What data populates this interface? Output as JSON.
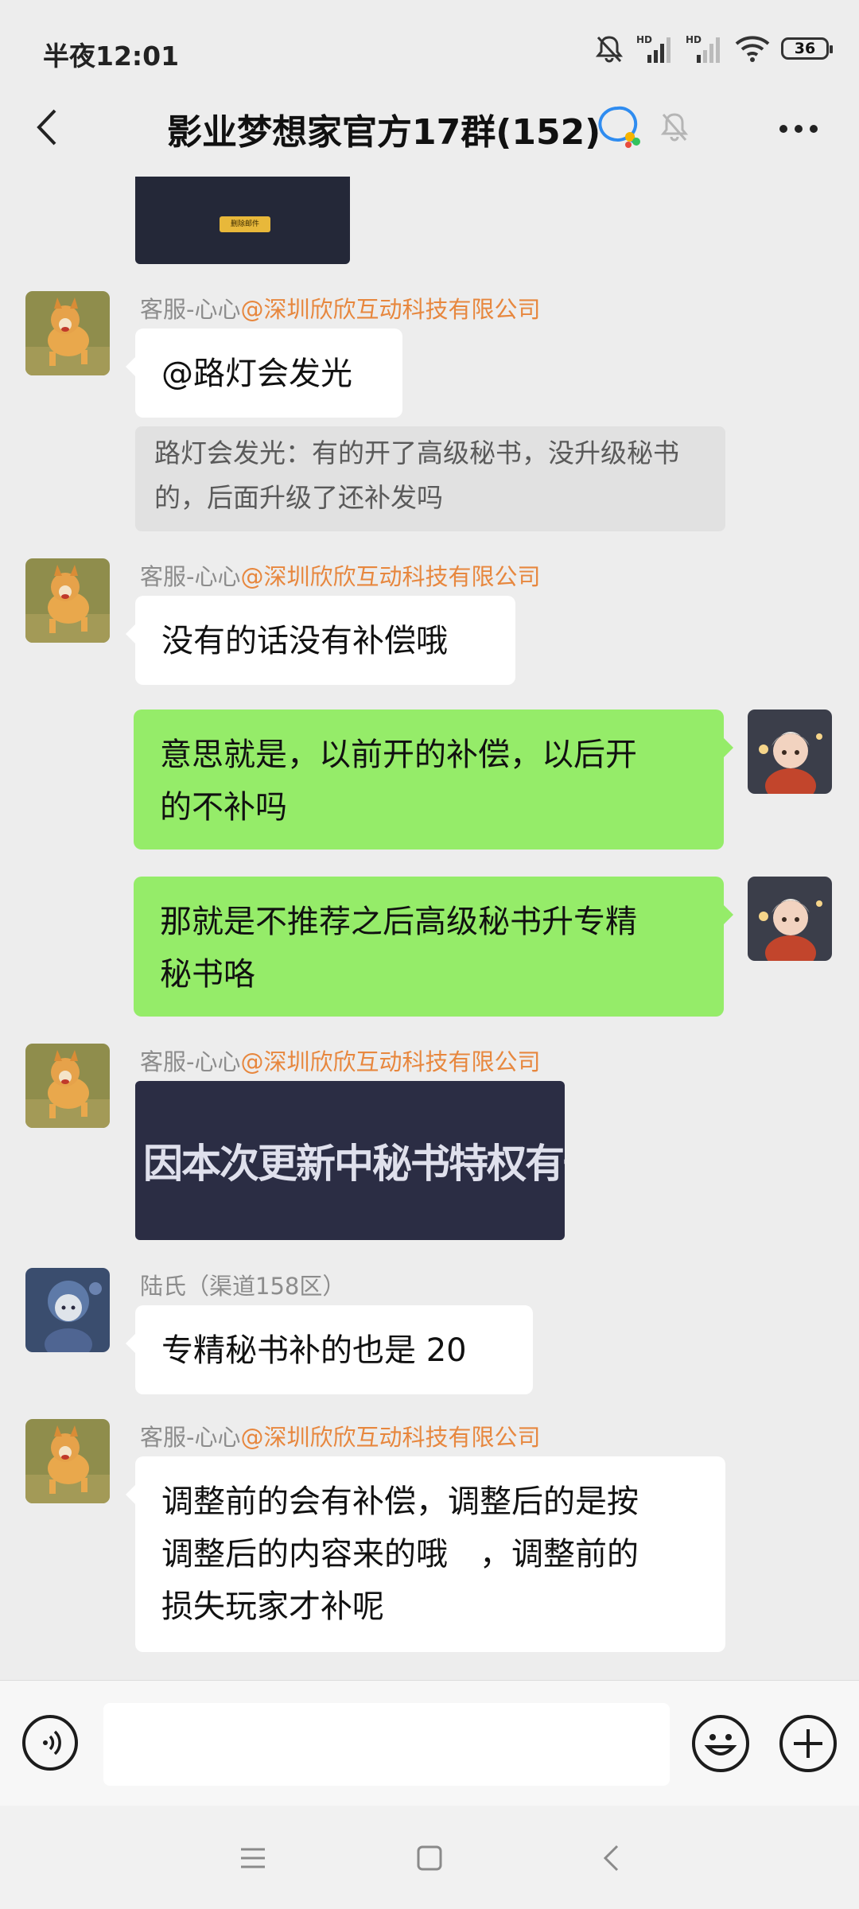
{
  "status_bar": {
    "time": "半夜12:01",
    "signal_1_label": "HD",
    "signal_2_label": "HD",
    "battery": "36",
    "icons": [
      "mute-notification-icon",
      "signal-icon",
      "signal-icon",
      "wifi-icon",
      "battery-icon"
    ]
  },
  "header": {
    "title": "影业梦想家官方17群(152)",
    "icons": [
      "back-icon",
      "group-chat-icon",
      "bell-muted-icon",
      "more-icon"
    ]
  },
  "messages": [
    {
      "type": "image",
      "side": "left",
      "partial": true,
      "caption": "删除邮件"
    },
    {
      "type": "text",
      "side": "left",
      "sender": "客服-心心",
      "org": "@深圳欣欣互动科技有限公司",
      "text": "@路灯会发光",
      "quote": "路灯会发光：有的开了高级秘书，没升级秘书的，后面升级了还补发吗"
    },
    {
      "type": "text",
      "side": "left",
      "sender": "客服-心心",
      "org": "@深圳欣欣互动科技有限公司",
      "text": "没有的话没有补偿哦"
    },
    {
      "type": "text",
      "side": "right",
      "text_lines": [
        "意思就是，以前开的补偿，以后开",
        "的不补吗"
      ]
    },
    {
      "type": "text",
      "side": "right",
      "text_lines": [
        "那就是不推荐之后高级秘书升专精",
        "秘书咯"
      ]
    },
    {
      "type": "image",
      "side": "left",
      "sender": "客服-心心",
      "org": "@深圳欣欣互动科技有限公司",
      "caption": "因本次更新中秘书特权有一定调整,"
    },
    {
      "type": "text",
      "side": "left",
      "sender": "陆氏（渠道158区）",
      "text": "专精秘书补的也是 20"
    },
    {
      "type": "text",
      "side": "left",
      "sender": "客服-心心",
      "org": "@深圳欣欣互动科技有限公司",
      "text_lines": [
        "调整前的会有补偿，调整后的是按",
        "调整后的内容来的哦　，调整前的",
        "损失玩家才补呢"
      ]
    }
  ],
  "input_bar": {
    "placeholder": "",
    "icons": [
      "voice-icon",
      "emoji-icon",
      "plus-icon"
    ]
  },
  "nav_bar": {
    "icons": [
      "menu-icon",
      "home-icon",
      "back-nav-icon"
    ]
  },
  "colors": {
    "background": "#ededed",
    "my_bubble": "#95ec69",
    "their_bubble": "#ffffff",
    "org_mention": "#e7873e",
    "sender_name": "#8c8c8c"
  }
}
